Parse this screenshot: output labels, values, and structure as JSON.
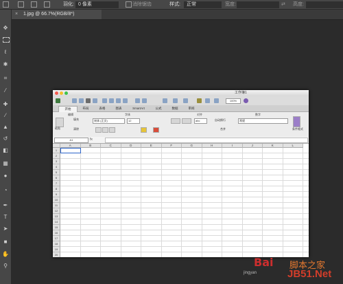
{
  "options_bar": {
    "feather_label": "羽化:",
    "feather_value": "0 像素",
    "antialias_label": "消除锯齿",
    "style_label": "样式:",
    "style_value": "正常",
    "width_label": "宽度:",
    "height_label": "高度:"
  },
  "document_tab": {
    "close_glyph": "×",
    "title": "1.jpg @ 66.7%(RGB/8*)"
  },
  "tools": [
    "move-tool",
    "marquee-tool",
    "lasso-tool",
    "magic-wand-tool",
    "crop-tool",
    "eyedropper-tool",
    "healing-tool",
    "brush-tool",
    "stamp-tool",
    "history-brush-tool",
    "eraser-tool",
    "gradient-tool",
    "blur-tool",
    "dodge-tool",
    "pen-tool",
    "type-tool",
    "path-select-tool",
    "shape-tool",
    "hand-tool",
    "zoom-tool"
  ],
  "excel": {
    "window_title": "工作簿1",
    "zoom": "100%",
    "ribbon_tabs": [
      "开始",
      "布局",
      "表格",
      "图表",
      "SmartArt",
      "公式",
      "数据",
      "审阅"
    ],
    "ribbon_groups": [
      "编辑",
      "字体",
      "对齐",
      "数字"
    ],
    "ribbon": {
      "paste_label": "粘贴",
      "fill_label": "填充",
      "clear_label": "清除",
      "font_name": "宋体 (正文)",
      "font_size": "12",
      "wrap_label": "自动换行",
      "merge_label": "合并",
      "number_format": "常规",
      "conditional_label": "条件格式",
      "abc_label": "abc"
    },
    "name_box": "A1",
    "fx_label": "fx",
    "columns": [
      "A",
      "B",
      "C",
      "D",
      "E",
      "F",
      "G",
      "H",
      "I",
      "J",
      "K",
      "L"
    ],
    "rows": [
      "1",
      "2",
      "3",
      "4",
      "5",
      "6",
      "7",
      "8",
      "9",
      "10",
      "11",
      "12",
      "13",
      "14",
      "15",
      "16",
      "17",
      "18",
      "19",
      "20"
    ]
  },
  "watermark": {
    "baidu": "Bai",
    "jingyan": "jingyan",
    "jb51": "JB51.Net",
    "jiaoben": "脚本之家"
  }
}
